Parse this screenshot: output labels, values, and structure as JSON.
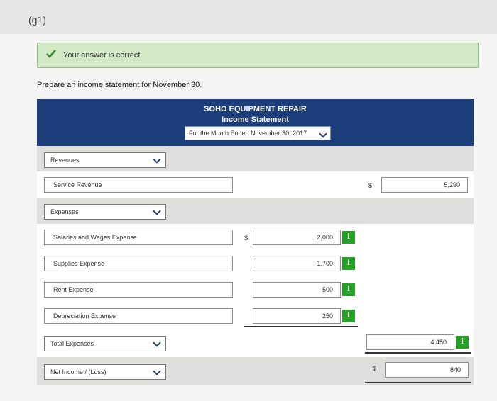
{
  "part_label": "(g1)",
  "feedback": {
    "message": "Your answer is correct.",
    "icon": "check-icon",
    "color": "#3a8a2a"
  },
  "instruction": "Prepare an income statement for November 30.",
  "header": {
    "company": "SOHO EQUIPMENT REPAIR",
    "statement": "Income Statement",
    "period": "For the Month Ended November 30, 2017",
    "color": "#1c3f7c"
  },
  "revenues": {
    "section_label": "Revenues",
    "item_label": "Service Revenue",
    "currency": "$",
    "amount": "5,290"
  },
  "expenses": {
    "section_label": "Expenses",
    "items": [
      {
        "label": "Salaries and Wages Expense",
        "currency": "$",
        "amount": "2,000"
      },
      {
        "label": "Supplies Expense",
        "currency": "",
        "amount": "1,700"
      },
      {
        "label": "Rent Expense",
        "currency": "",
        "amount": "500"
      },
      {
        "label": "Depreciation Expense",
        "currency": "",
        "amount": "250"
      }
    ],
    "total_label": "Total Expenses",
    "total_amount": "4,450"
  },
  "net_income": {
    "label": "Net Income / (Loss)",
    "currency": "$",
    "amount": "840"
  },
  "info_glyph": "i"
}
